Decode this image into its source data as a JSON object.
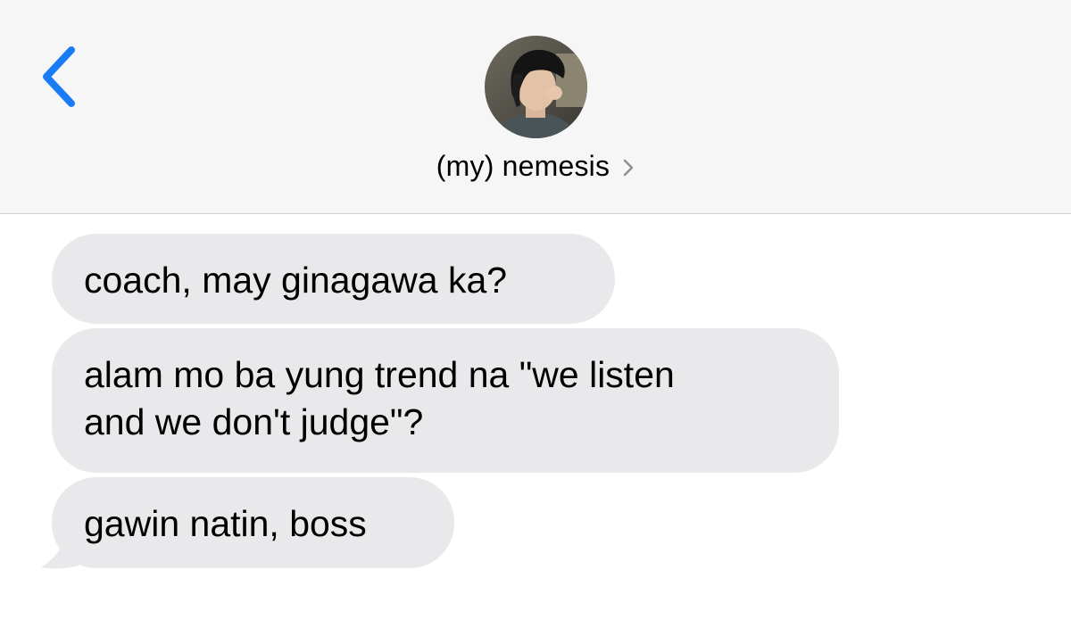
{
  "header": {
    "contact_name": "(my) nemesis",
    "back_icon": "chevron-left-icon",
    "details_icon": "chevron-right-icon",
    "accent_color": "#1a7cf5"
  },
  "messages": [
    {
      "direction": "incoming",
      "text": "coach, may ginagawa ka?"
    },
    {
      "direction": "incoming",
      "text": "alam mo ba yung trend na \"we listen\nand we don't judge\"?"
    },
    {
      "direction": "incoming",
      "text": "gawin natin, boss"
    }
  ],
  "colors": {
    "header_bg": "#f6f6f6",
    "incoming_bubble": "#e9e9eb",
    "page_bg": "#ffffff"
  }
}
